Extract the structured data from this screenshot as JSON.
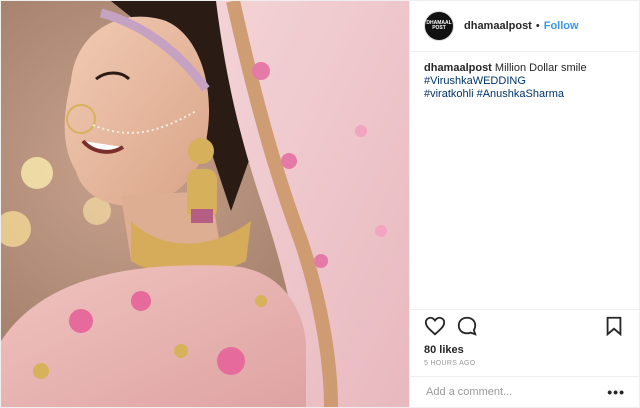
{
  "header": {
    "username": "dhamaalpost",
    "separator": "•",
    "follow_label": "Follow",
    "avatar_text": "DHAMAAL POST"
  },
  "caption": {
    "username": "dhamaalpost",
    "text": "Million Dollar smile",
    "hashtags": [
      "#VirushkaWEDDING",
      "#viratkohli",
      "#AnushkaSharma"
    ]
  },
  "icons": {
    "like": "heart-icon",
    "comment": "comment-icon",
    "save": "bookmark-icon",
    "more": "more-options-icon"
  },
  "likes_text": "80 likes",
  "timestamp": "5 HOURS AGO",
  "comment_box": {
    "placeholder": "Add a comment...",
    "more_label": "•••"
  },
  "colors": {
    "link": "#003569",
    "follow": "#3897f0",
    "border": "#efefef",
    "muted": "#999999"
  }
}
